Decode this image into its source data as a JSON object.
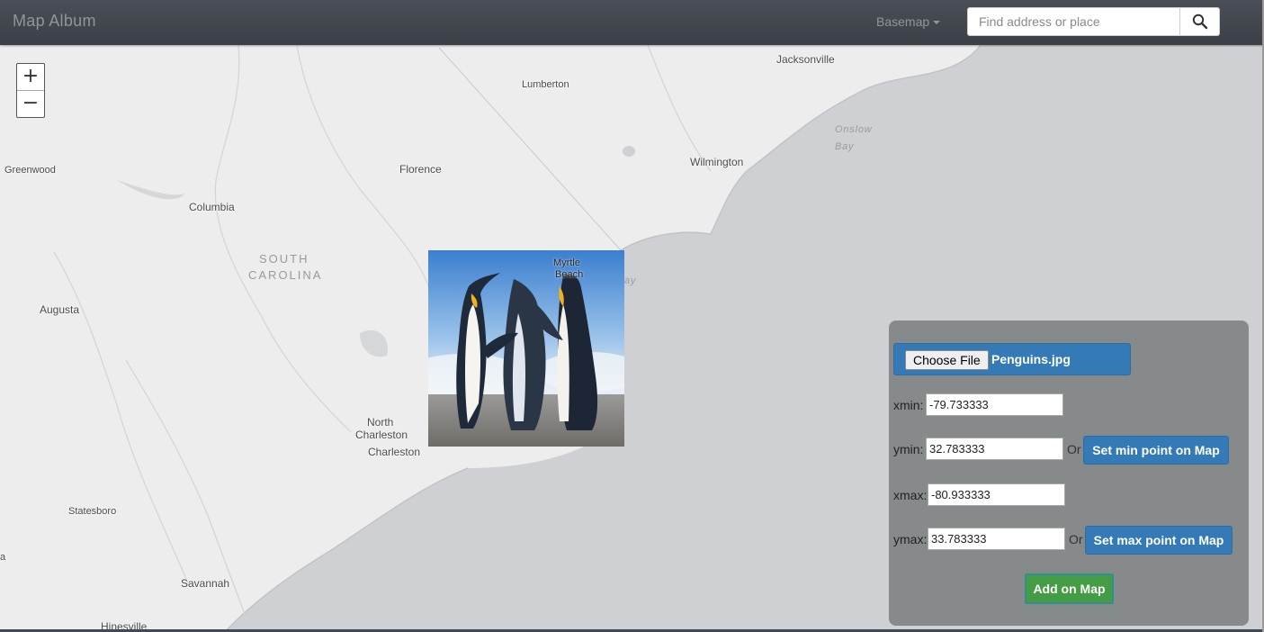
{
  "navbar": {
    "brand": "Map Album",
    "basemap_label": "Basemap",
    "search_placeholder": "Find address or place",
    "search_value": ""
  },
  "map": {
    "zoom_in": "+",
    "zoom_out": "−",
    "places": {
      "jacksonville": "Jacksonville",
      "lumberton": "Lumberton",
      "onslow": "Onslow",
      "bay": "Bay",
      "greenwood": "Greenwood",
      "florence": "Florence",
      "wilmington": "Wilmington",
      "columbia": "Columbia",
      "south": "SOUTH",
      "carolina": "CAROLINA",
      "myrtle": "Myrtle",
      "beach": "Beach",
      "bay_partial": "ay",
      "augusta": "Augusta",
      "north_charleston_1": "North",
      "north_charleston_2": "Charleston",
      "charleston": "Charleston",
      "statesboro": "Statesboro",
      "a_partial": "a",
      "savannah": "Savannah",
      "hinesville": "Hinesville"
    },
    "overlay_image": "penguins-photo"
  },
  "panel": {
    "choose_file_label": "Choose File",
    "file_name": "Penguins.jpg",
    "xmin_label": "xmin:",
    "xmin_value": "-79.733333",
    "ymin_label": "ymin:",
    "ymin_value": "32.783333",
    "xmax_label": "xmax:",
    "xmax_value": "-80.933333",
    "ymax_label": "ymax:",
    "ymax_value": "33.783333",
    "or_label_1": "Or",
    "or_label_2": "Or",
    "set_min_button": "Set min point on Map",
    "set_max_button": "Set max point on Map",
    "add_button": "Add on Map"
  },
  "colors": {
    "navbar": "#3f444b",
    "land": "#ededed",
    "water": "#cfd0d3",
    "panel": "#868a8a",
    "primary": "#337ab7",
    "success": "#449d44"
  }
}
